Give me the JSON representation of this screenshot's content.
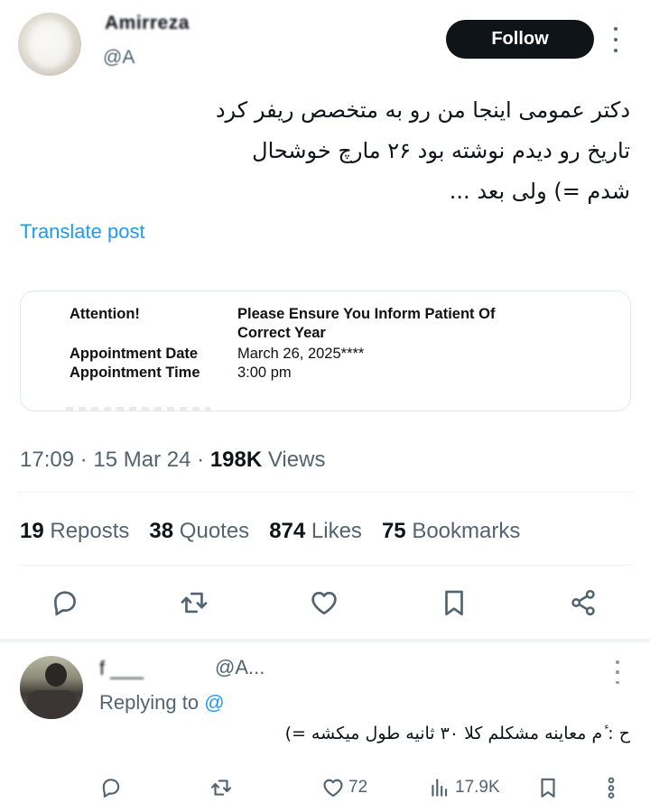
{
  "post": {
    "author_name": "Amirreza",
    "author_handle": "@A",
    "follow_label": "Follow",
    "text_lines": [
      "دکتر عمومی اینجا من رو به متخصص ریفر کرد",
      "تاریخ رو دیدم نوشته بود ۲۶ مارچ خوشحال",
      "شدم =) ولی بعد ..."
    ],
    "translate_label": "Translate post",
    "card": {
      "attention_label": "Attention!",
      "attention_value_line1": "Please Ensure You Inform Patient Of",
      "attention_value_line2": "Correct Year",
      "date_label": "Appointment Date",
      "date_value": "March 26, 2025****",
      "time_label": "Appointment Time",
      "time_value": "3:00 pm"
    },
    "meta": {
      "time": "17:09",
      "date": "15 Mar 24",
      "views_count": "198K",
      "views_label": "Views",
      "sep": "·"
    },
    "stats": {
      "reposts_count": "19",
      "reposts_label": "Reposts",
      "quotes_count": "38",
      "quotes_label": "Quotes",
      "likes_count": "874",
      "likes_label": "Likes",
      "bookmarks_count": "75",
      "bookmarks_label": "Bookmarks"
    },
    "actions": [
      "reply-icon",
      "repost-icon",
      "like-icon",
      "bookmark-icon",
      "share-icon"
    ]
  },
  "reply": {
    "author_name": "f ___",
    "author_handle": "@A...",
    "replying_prefix": "Replying to",
    "replying_handle": "@",
    "text": "ح : ٔم معاینه مشکلم کلا ۳۰ ثانیه طول میکشه =)",
    "likes": "72",
    "views": "17.9K"
  },
  "colors": {
    "accent": "#1d9bf0",
    "text_primary": "#0f1419",
    "text_secondary": "#536471",
    "follow_bg": "#0f1419"
  }
}
